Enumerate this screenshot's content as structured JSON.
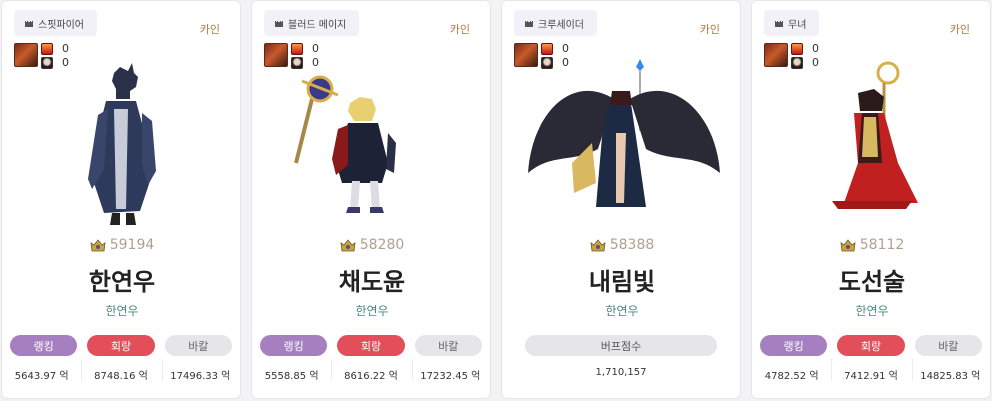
{
  "cards": [
    {
      "job": "스핏파이어",
      "server": "카인",
      "buff_counts": [
        "0",
        "0"
      ],
      "fame": "59194",
      "name": "한연우",
      "adventure": "한연우",
      "tags": [
        "랭킹",
        "회랑",
        "바칼"
      ],
      "values": [
        "5643.97 억",
        "8748.16 억",
        "17496.33 억"
      ]
    },
    {
      "job": "블러드 메이지",
      "server": "카인",
      "buff_counts": [
        "0",
        "0"
      ],
      "fame": "58280",
      "name": "채도윤",
      "adventure": "한연우",
      "tags": [
        "랭킹",
        "회랑",
        "바칼"
      ],
      "values": [
        "5558.85 억",
        "8616.22 억",
        "17232.45 억"
      ]
    },
    {
      "job": "크루세이더",
      "server": "카인",
      "buff_counts": [
        "0",
        "0"
      ],
      "fame": "58388",
      "name": "내림빛",
      "adventure": "한연우",
      "tags": [
        "버프점수"
      ],
      "values": [
        "1,710,157"
      ]
    },
    {
      "job": "무녀",
      "server": "카인",
      "buff_counts": [
        "0",
        "0"
      ],
      "fame": "58112",
      "name": "도선술",
      "adventure": "한연우",
      "tags": [
        "랭킹",
        "회랑",
        "바칼"
      ],
      "values": [
        "4782.52 억",
        "7412.91 억",
        "14825.83 억"
      ]
    }
  ],
  "colors": {
    "rank": "#a57fbf",
    "cycle": "#e24e5a",
    "neutral": "#e6e6e8",
    "server": "#b07a45",
    "adventure": "#4a8a7a",
    "fame": "#b0a08e"
  },
  "icons": {
    "job": "castle-icon",
    "fame": "crown-badge-icon",
    "buff_main": "demon-portrait-icon",
    "buff_red": "red-gem-icon",
    "buff_face": "character-face-icon"
  }
}
